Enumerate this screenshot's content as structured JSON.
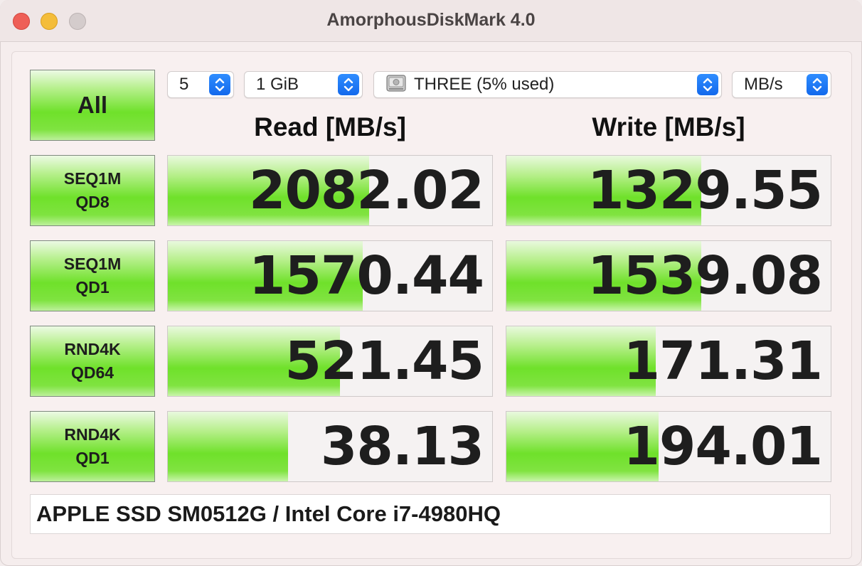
{
  "window": {
    "title": "AmorphousDiskMark 4.0"
  },
  "controls": {
    "all_label": "All",
    "count": "5",
    "size": "1 GiB",
    "disk": "THREE (5% used)",
    "unit": "MB/s"
  },
  "headers": {
    "read": "Read [MB/s]",
    "write": "Write [MB/s]"
  },
  "tests": [
    {
      "line1": "SEQ1M",
      "line2": "QD8",
      "read": "2082.02",
      "write": "1329.55",
      "read_fill_pct": 62,
      "write_fill_pct": 60
    },
    {
      "line1": "SEQ1M",
      "line2": "QD1",
      "read": "1570.44",
      "write": "1539.08",
      "read_fill_pct": 60,
      "write_fill_pct": 60
    },
    {
      "line1": "RND4K",
      "line2": "QD64",
      "read": "521.45",
      "write": "171.31",
      "read_fill_pct": 53,
      "write_fill_pct": 46
    },
    {
      "line1": "RND4K",
      "line2": "QD1",
      "read": "38.13",
      "write": "194.01",
      "read_fill_pct": 37,
      "write_fill_pct": 47
    }
  ],
  "footer": {
    "info": "APPLE SSD SM0512G / Intel Core i7-4980HQ"
  },
  "colors": {
    "accent_blue": "#1a74f2",
    "bar_green": "#6fe12a"
  },
  "icons": {
    "select_chevron": "chevron-updown-icon",
    "disk": "hard-disk-icon"
  }
}
